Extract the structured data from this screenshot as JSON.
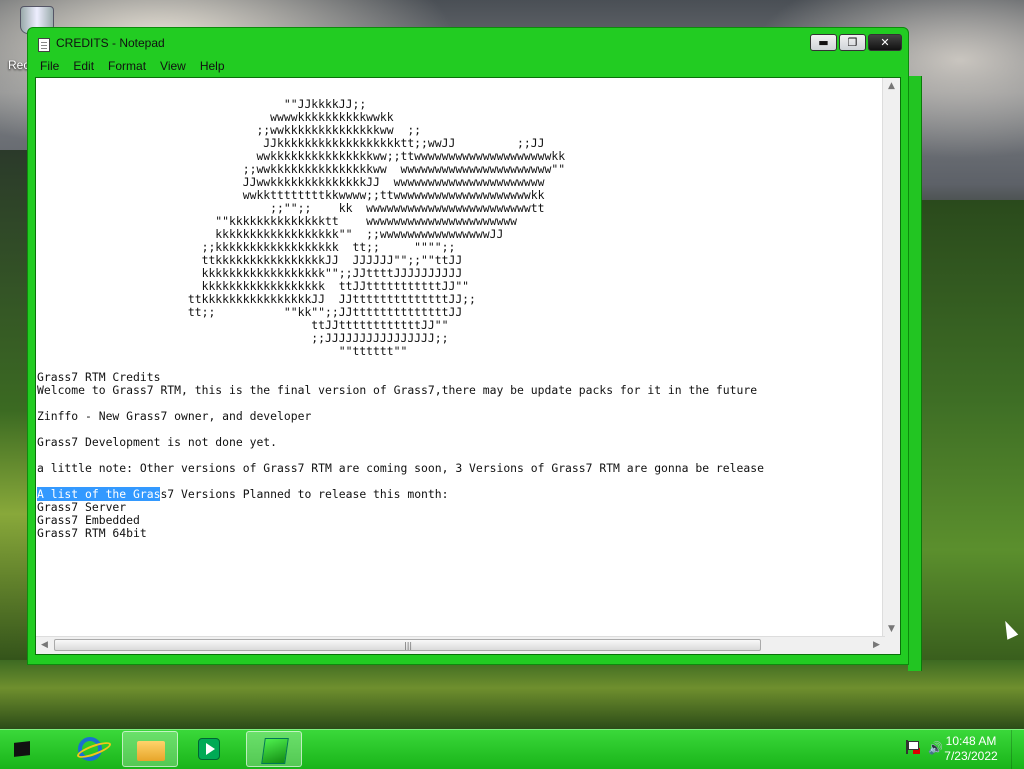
{
  "desktop": {
    "recycle_bin_label": "Rec"
  },
  "window": {
    "title": "CREDITS - Notepad",
    "buttons": {
      "minimize": "▬",
      "maximize": "❐",
      "close": "✕"
    },
    "menu": [
      "File",
      "Edit",
      "Format",
      "View",
      "Help"
    ]
  },
  "document": {
    "ascii_art": [
      "                                    \"\"JJkkkkJJ;;",
      "                                  wwwwkkkkkkkkkkwwkk",
      "                                ;;wwkkkkkkkkkkkkkkww  ;;",
      "                                 JJkkkkkkkkkkkkkkkkkktt;;wwJJ         ;;JJ",
      "                                wwkkkkkkkkkkkkkkkww;;ttwwwwwwwwwwwwwwwwwwwwkk",
      "                              ;;wwkkkkkkkkkkkkkkkww  wwwwwwwwwwwwwwwwwwwwww\"\"",
      "                              JJwwkkkkkkkkkkkkkkJJ  wwwwwwwwwwwwwwwwwwwwww",
      "                              wwkkttttttttkkwwww;;ttwwwwwwwwwwwwwwwwwwwwkk",
      "                                  ;;\"\";;    kk  wwwwwwwwwwwwwwwwwwwwwwwwtt",
      "                          \"\"kkkkkkkkkkkkkktt    wwwwwwwwwwwwwwwwwwwwww",
      "                          kkkkkkkkkkkkkkkkkk\"\"  ;;wwwwwwwwwwwwwwwwJJ",
      "                        ;;kkkkkkkkkkkkkkkkkk  tt;;     \"\"\"\";;",
      "                        ttkkkkkkkkkkkkkkkkJJ  JJJJJJ\"\";;\"\"ttJJ",
      "                        kkkkkkkkkkkkkkkkkk\"\";;JJttttJJJJJJJJJJ",
      "                        kkkkkkkkkkkkkkkkkk  ttJJtttttttttttJJ\"\"",
      "                      ttkkkkkkkkkkkkkkkkJJ  JJttttttttttttttJJ;;",
      "                      tt;;          \"\"kk\"\";;JJttttttttttttttJJ",
      "                                        ttJJttttttttttttJJ\"\"",
      "                                        ;;JJJJJJJJJJJJJJJJ;;",
      "                                            \"\"tttttt\"\""
    ],
    "blank1": "",
    "heading": "Grass7 RTM Credits",
    "welcome": "Welcome to Grass7 RTM, this is the final version of Grass7,there may be update packs for it in the future",
    "blank2": "",
    "owner": "Zinffo - New Grass7 owner, and developer",
    "blank3": "",
    "dev_note": "Grass7 Development is not done yet.",
    "blank4": "",
    "little_note": "a little note: Other versions of Grass7 RTM are coming soon, 3 Versions of Grass7 RTM are gonna be release",
    "blank5": "",
    "list_selected": "A list of the Gras",
    "list_rest": "s7 Versions Planned to release this month:",
    "versions": [
      "Grass7 Server",
      "Grass7 Embedded",
      "Grass7 RTM 64bit"
    ]
  },
  "scrollbar": {
    "up": "▲",
    "down": "▼",
    "left": "◀",
    "right": "▶",
    "grip": "|||"
  },
  "taskbar": {
    "clock_time": "10:48 AM",
    "clock_date": "7/23/2022",
    "volume_icon": "🔊"
  }
}
